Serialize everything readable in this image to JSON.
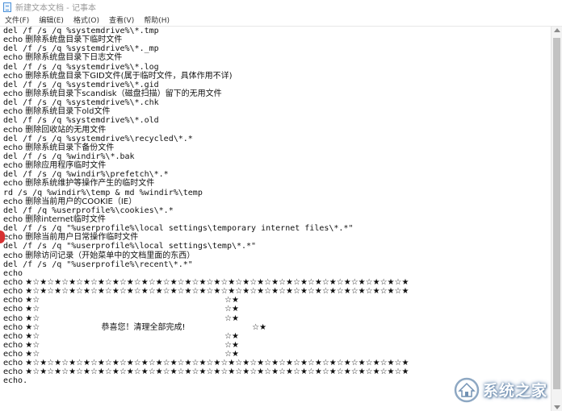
{
  "window": {
    "title": "新建文本文档 - 记事本",
    "app_icon": "notepad-icon"
  },
  "menu": [
    {
      "label": "文件(F)"
    },
    {
      "label": "编辑(E)"
    },
    {
      "label": "格式(O)"
    },
    {
      "label": "查看(V)"
    },
    {
      "label": "帮助(H)"
    }
  ],
  "editor": {
    "lines": [
      {
        "text": "del /f /s /q %systemdrive%\\*.tmp",
        "cn": false
      },
      {
        "text": "echo 删除系统盘目录下临时文件",
        "cn": true
      },
      {
        "text": "del /f /s /q %systemdrive%\\*._mp",
        "cn": false
      },
      {
        "text": "echo 删除系统盘目录下日志文件",
        "cn": true
      },
      {
        "text": "del /f /s /q %systemdrive%\\*.log",
        "cn": false
      },
      {
        "text": "echo 删除系统盘目录下GID文件(属于临时文件，具体作用不详)",
        "cn": true
      },
      {
        "text": "del /f /s /q %systemdrive%\\*.gid",
        "cn": false
      },
      {
        "text": "echo 删除系统目录下scandisk（磁盘扫描）留下的无用文件",
        "cn": true
      },
      {
        "text": "del /f /s /q %systemdrive%\\*.chk",
        "cn": false
      },
      {
        "text": "echo 删除系统目录下old文件",
        "cn": true
      },
      {
        "text": "del /f /s /q %systemdrive%\\*.old",
        "cn": false
      },
      {
        "text": "echo 删除回收站的无用文件",
        "cn": true
      },
      {
        "text": "del /f /s /q %systemdrive%\\recycled\\*.*",
        "cn": false
      },
      {
        "text": "echo 删除系统目录下备份文件",
        "cn": true
      },
      {
        "text": "del /f /s /q %windir%\\*.bak",
        "cn": false
      },
      {
        "text": "echo 删除应用程序临时文件",
        "cn": true
      },
      {
        "text": "del /f /s /q %windir%\\prefetch\\*.*",
        "cn": false
      },
      {
        "text": "echo 删除系统维护等操作产生的临时文件",
        "cn": true
      },
      {
        "text": "rd /s /q %windir%\\temp & md %windir%\\temp",
        "cn": false
      },
      {
        "text": "echo 删除当前用户的COOKIE（IE）",
        "cn": true
      },
      {
        "text": "del /f /q %userprofile%\\cookies\\*.*",
        "cn": false
      },
      {
        "text": "echo 删除internet临时文件",
        "cn": true
      },
      {
        "text": "del /f /s /q \"%userprofile%\\local settings\\temporary internet files\\*.*\"",
        "cn": false
      },
      {
        "text": "echo 删除当前用户日常操作临时文件",
        "cn": true
      },
      {
        "text": "del /f /s /q \"%userprofile%\\local settings\\temp\\*.*\"",
        "cn": false
      },
      {
        "text": "echo 删除访问记录（开始菜单中的文档里面的东西）",
        "cn": true
      },
      {
        "text": "del /f /s /q \"%userprofile%\\recent\\*.*\"",
        "cn": false
      },
      {
        "text": "echo",
        "cn": false
      },
      {
        "text": "echo ★☆★☆★☆★☆★☆★☆★☆★☆★☆★☆★☆★☆★☆★☆★☆★☆★☆★☆★☆★☆★☆★☆★☆★☆★☆★☆★",
        "cn": true
      },
      {
        "text": "echo ★☆★☆★☆★☆★☆★☆★☆★☆★☆★☆★☆★☆★☆★☆★☆★☆★☆★☆★☆★☆★☆★☆★☆★☆★☆★☆★",
        "cn": true
      },
      {
        "text": "echo ★☆                                                                        ☆★",
        "cn": true
      },
      {
        "text": "echo ★☆                                                                        ☆★",
        "cn": true
      },
      {
        "text": "echo ★☆                                                                        ☆★",
        "cn": true
      },
      {
        "text": "echo ★☆                        恭喜您！清理全部完成!                          ☆★",
        "cn": true
      },
      {
        "text": "echo ★☆                                                                        ☆★",
        "cn": true
      },
      {
        "text": "echo ★☆                                                                        ☆★",
        "cn": true
      },
      {
        "text": "echo ★☆                                                                        ☆★",
        "cn": true
      },
      {
        "text": "echo ★☆★☆★☆★☆★☆★☆★☆★☆★☆★☆★☆★☆★☆★☆★☆★☆★☆★☆★☆★☆★☆★☆★☆★☆★☆★☆★",
        "cn": true
      },
      {
        "text": "echo ★☆★☆★☆★☆★☆★☆★☆★☆★☆★☆★☆★☆★☆★☆★☆★☆★☆★☆★☆★☆★☆★☆★☆★☆★☆★☆★",
        "cn": true
      },
      {
        "text": "echo.",
        "cn": false
      }
    ]
  },
  "watermark": {
    "text": "系统之家",
    "icon": "house-logo-icon"
  }
}
